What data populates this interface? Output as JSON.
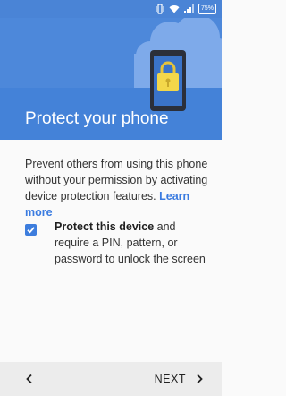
{
  "status_bar": {
    "battery_text": "75%",
    "icons": [
      "vibrate-icon",
      "wifi-icon",
      "signal-icon",
      "battery-icon"
    ]
  },
  "header": {
    "title": "Protect your phone",
    "illustration": "phone-lock-icon",
    "colors": {
      "background": "#4a84d6",
      "cloud": "#6fa0e6",
      "lock": "#f3d74a"
    }
  },
  "body": {
    "description": "Prevent others from using this phone without your permission by activating device protection features.",
    "learn_more_link": "Learn more",
    "checkbox": {
      "checked": true,
      "label_bold": "Protect this device",
      "label_rest": "and require a PIN, pattern, or password to unlock the screen"
    }
  },
  "navigation": {
    "back_icon": "chevron-left-icon",
    "next_label": "NEXT",
    "next_icon": "chevron-right-icon"
  },
  "accent_color": "#3a7be0"
}
